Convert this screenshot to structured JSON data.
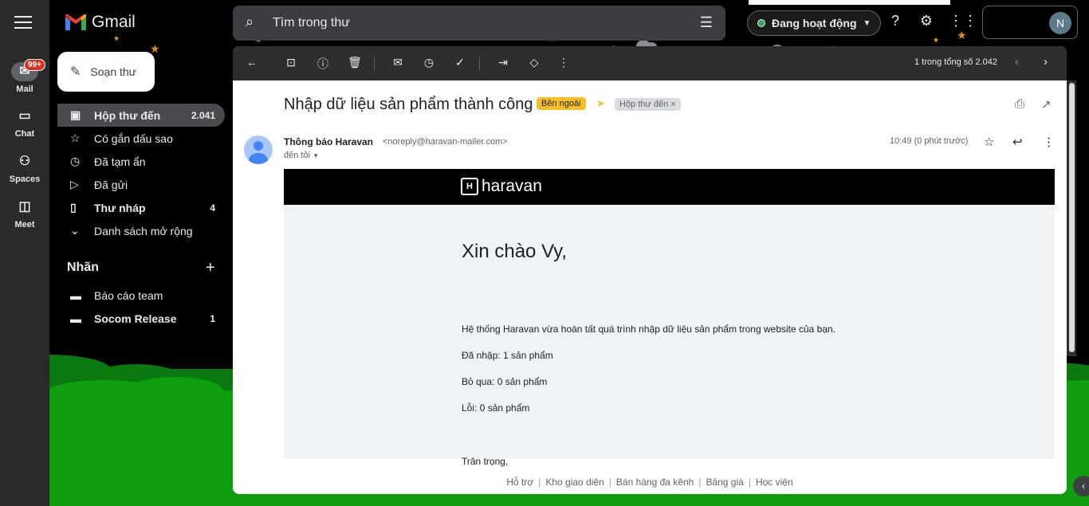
{
  "app": {
    "logo_text": "Gmail",
    "badge": "99+"
  },
  "rail": {
    "mail": "Mail",
    "chat": "Chat",
    "spaces": "Spaces",
    "meet": "Meet"
  },
  "search": {
    "placeholder": "Tìm trong thư"
  },
  "status": {
    "label": "Đang hoạt động"
  },
  "avatar": {
    "initial": "N"
  },
  "compose": {
    "label": "Soạn thư"
  },
  "nav": {
    "inbox": {
      "label": "Hộp thư đến",
      "count": "2.041"
    },
    "starred": {
      "label": "Có gắn dấu sao"
    },
    "snoozed": {
      "label": "Đã tạm ẩn"
    },
    "sent": {
      "label": "Đã gửi"
    },
    "drafts": {
      "label": "Thư nháp",
      "count": "4"
    },
    "more": {
      "label": "Danh sách mở rộng"
    }
  },
  "labels": {
    "header": "Nhãn",
    "items": [
      {
        "label": "Báo cáo team",
        "count": ""
      },
      {
        "label": "Socom Release",
        "count": "1"
      }
    ]
  },
  "toolbar": {
    "paging": "1 trong tổng số 2.042"
  },
  "message": {
    "subject": "Nhập dữ liệu sản phẩm thành công",
    "tag_external": "Bên ngoài",
    "tag_inbox": "Hộp thư đến",
    "sender_name": "Thông báo Haravan",
    "sender_email": "<noreply@haravan-mailer.com>",
    "to": "đến tôi",
    "time": "10:49 (0 phút trước)"
  },
  "email": {
    "brand": "haravan",
    "brand_mark": "H",
    "greeting": "Xin chào Vy,",
    "intro": "Hệ thống Haravan vừa hoàn tất quá trình nhập dữ liệu sản phẩm trong website của bạn.",
    "imported": "Đã nhập: 1 sản phẩm",
    "skipped": "Bỏ qua: 0 sản phẩm",
    "errors": "Lỗi: 0 sản phẩm",
    "closing": "Trân trọng,"
  },
  "footer": {
    "links": [
      "Hỗ trợ",
      "Kho giao diện",
      "Bán hàng đa kênh",
      "Bảng giá",
      "Học viện"
    ]
  },
  "colors": {
    "tag_external": "#f6bf26",
    "status_online": "#34a853",
    "badge": "#d93025",
    "hill": "#0e9e0e"
  }
}
